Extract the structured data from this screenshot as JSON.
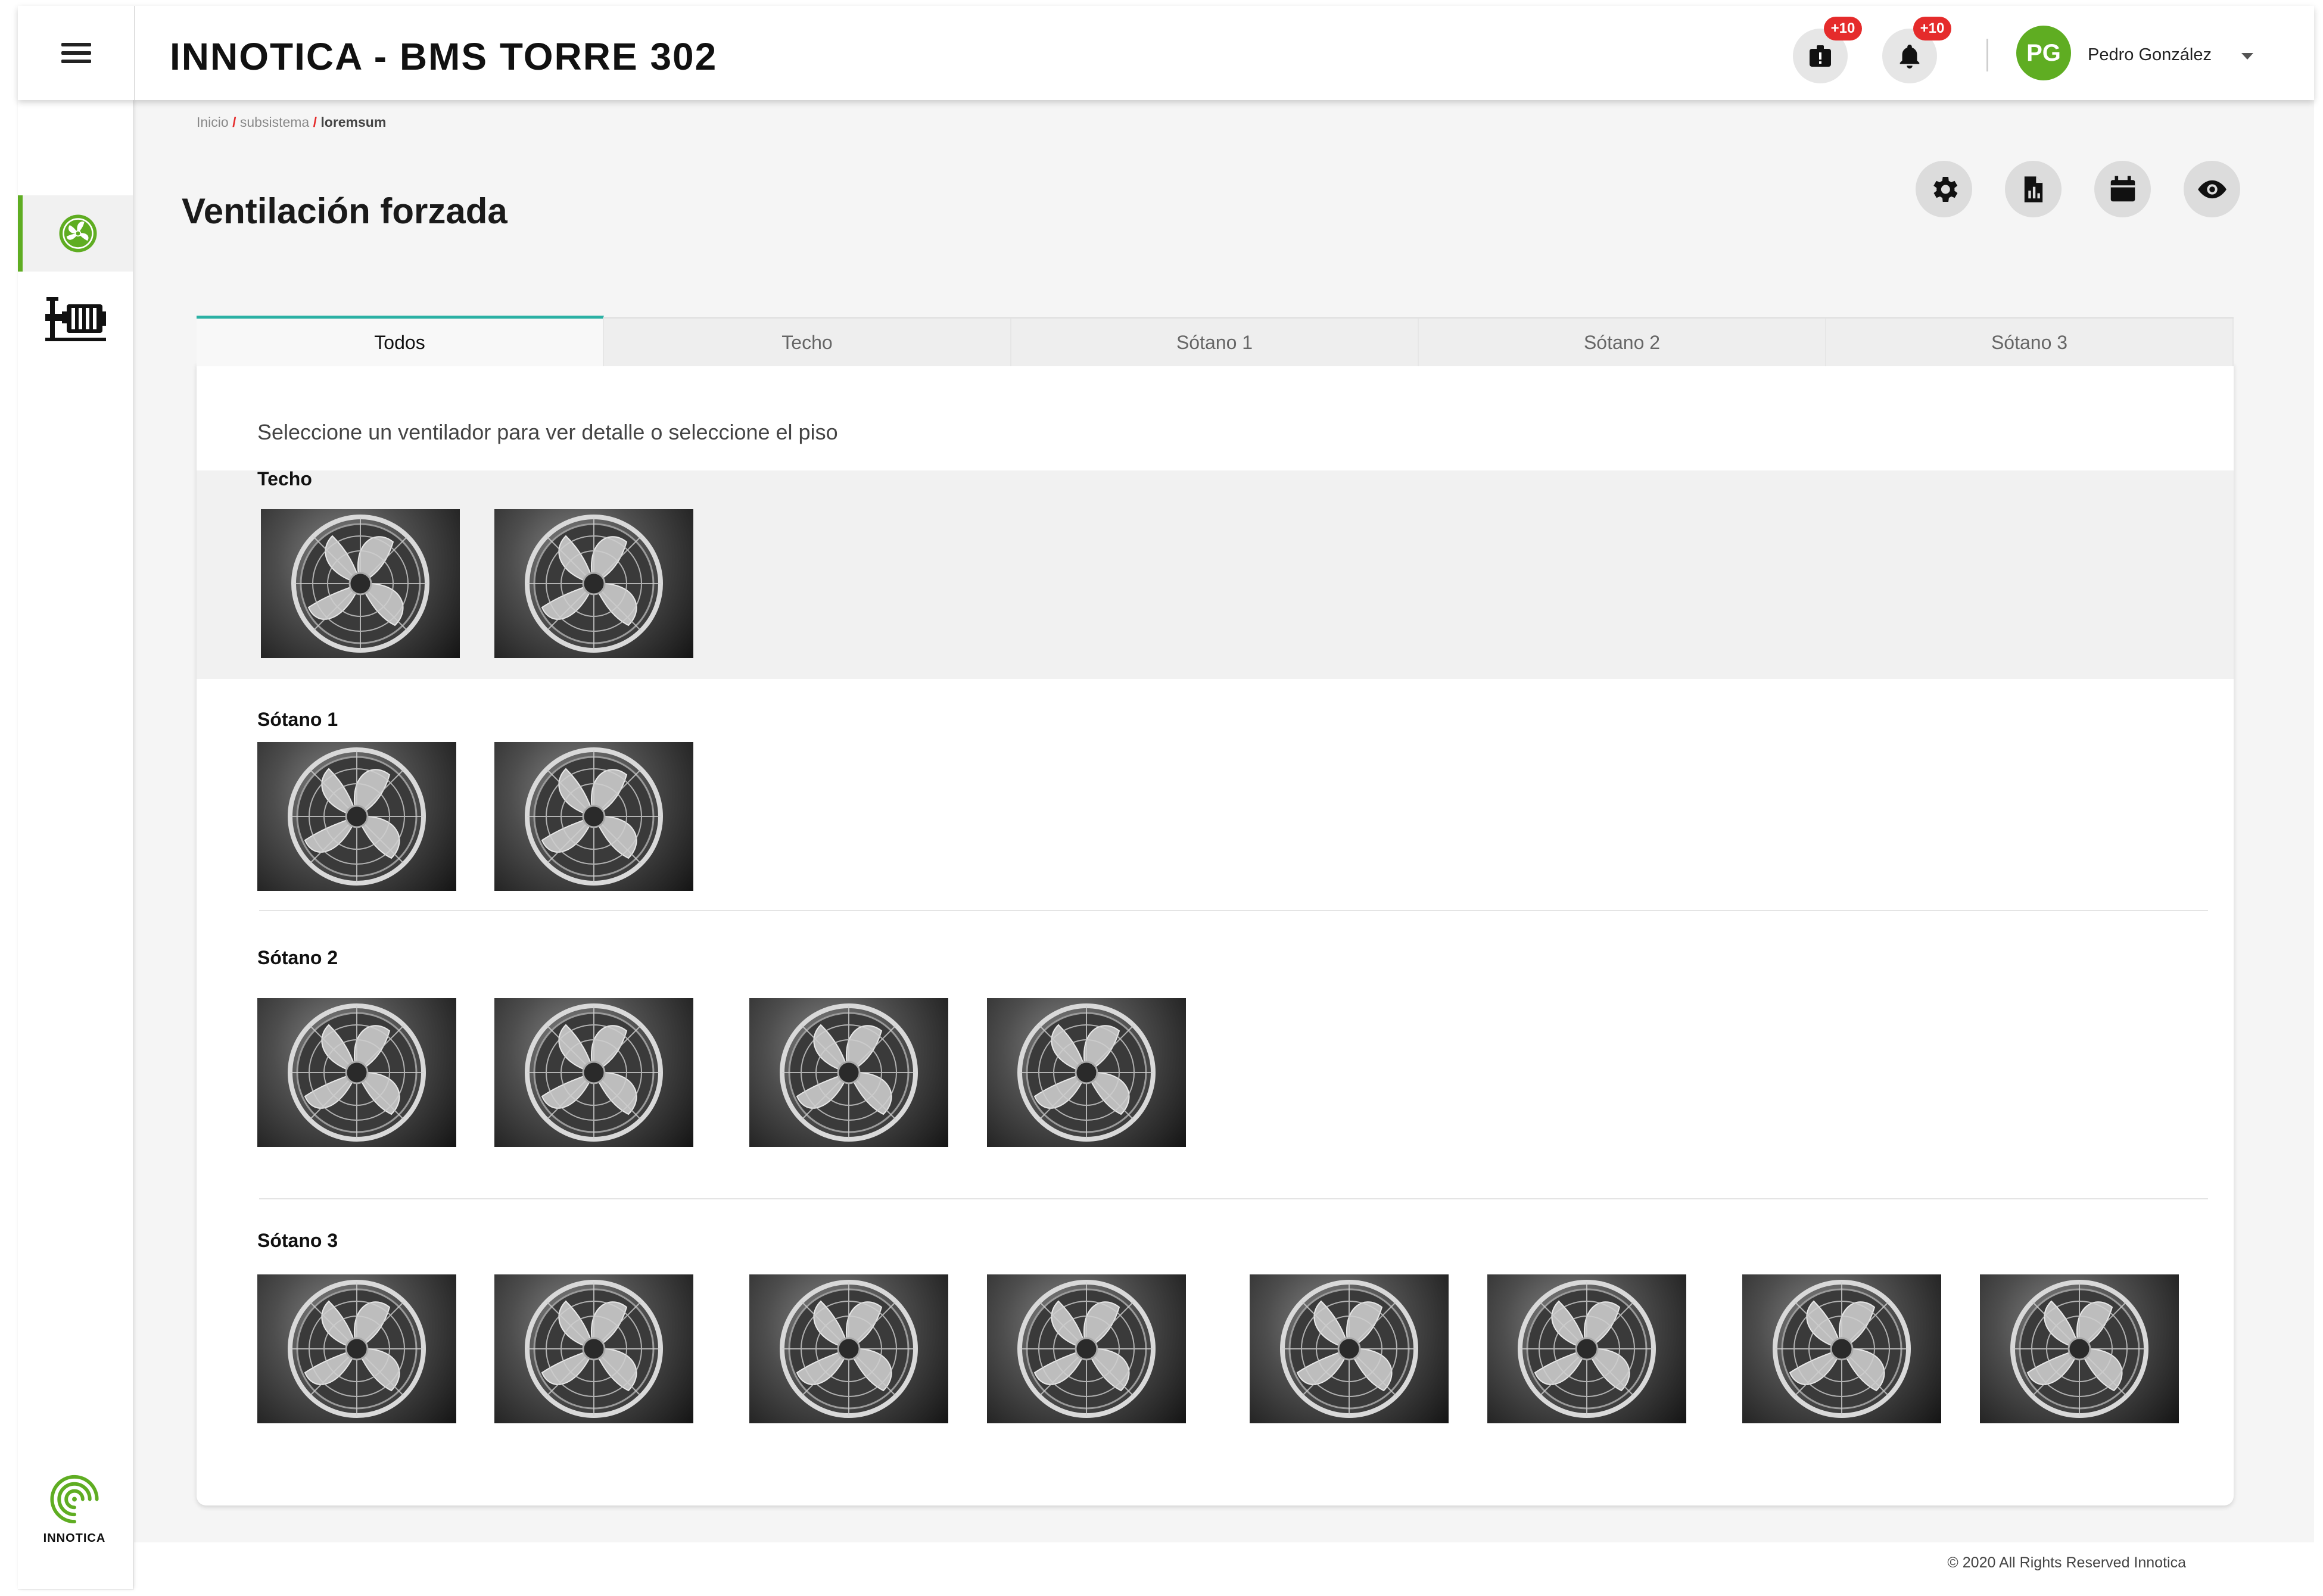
{
  "header": {
    "title": "INNOTICA - BMS TORRE 302",
    "alerts_badge": "+10",
    "notifications_badge": "+10",
    "user_initials": "PG",
    "user_name": "Pedro González"
  },
  "breadcrumb": {
    "home": "Inicio",
    "level1": "subsistema",
    "current": "loremsum",
    "separator": "/"
  },
  "page": {
    "title": "Ventilación forzada"
  },
  "toolbar": {
    "icons": [
      "settings-icon",
      "report-icon",
      "calendar-icon",
      "eye-icon"
    ]
  },
  "sidebar": {
    "items": [
      {
        "icon": "fan-icon",
        "active": true
      },
      {
        "icon": "pump-icon",
        "active": false
      }
    ],
    "logo_text": "INNOTICA"
  },
  "tabs": [
    "Todos",
    "Techo",
    "Sótano 1",
    "Sótano 2",
    "Sótano 3"
  ],
  "active_tab": "Todos",
  "content": {
    "instruction": "Seleccione un ventilador para ver detalle o seleccione el piso",
    "groups": [
      {
        "name": "Techo",
        "fans": 2
      },
      {
        "name": "Sótano 1",
        "fans": 2
      },
      {
        "name": "Sótano 2",
        "fans": 4
      },
      {
        "name": "Sótano 3",
        "fans": 8
      }
    ]
  },
  "footer": {
    "copyright": "© 2020 All Rights Reserved Innotica"
  },
  "colors": {
    "brand_green": "#5fad22",
    "badge_red": "#e52b2b",
    "tab_accent": "#2bb1a4"
  }
}
